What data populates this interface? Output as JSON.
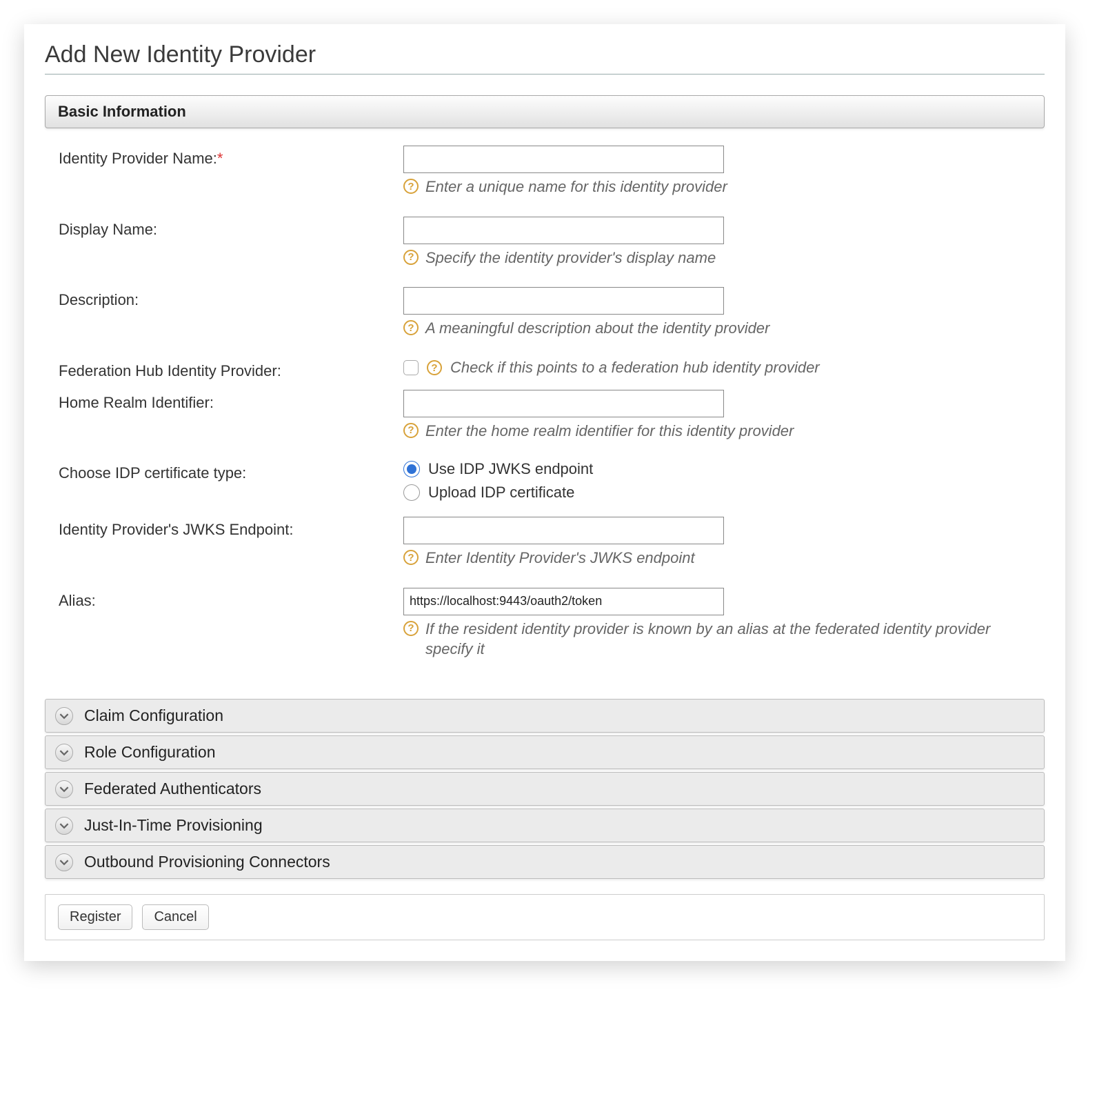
{
  "page": {
    "title": "Add New Identity Provider"
  },
  "basic_info": {
    "header": "Basic Information",
    "idp_name": {
      "label": "Identity Provider Name:",
      "required_mark": "*",
      "value": "",
      "hint": "Enter a unique name for this identity provider"
    },
    "display_name": {
      "label": "Display Name:",
      "value": "",
      "hint": "Specify the identity provider's display name"
    },
    "description": {
      "label": "Description:",
      "value": "",
      "hint": "A meaningful description about the identity provider"
    },
    "federation_hub": {
      "label": "Federation Hub Identity Provider:",
      "checked": false,
      "hint": "Check if this points to a federation hub identity provider"
    },
    "home_realm": {
      "label": "Home Realm Identifier:",
      "value": "",
      "hint": "Enter the home realm identifier for this identity provider"
    },
    "cert_type": {
      "label": "Choose IDP certificate type:",
      "options": [
        {
          "label": "Use IDP JWKS endpoint",
          "selected": true
        },
        {
          "label": "Upload IDP certificate",
          "selected": false
        }
      ]
    },
    "jwks_endpoint": {
      "label": "Identity Provider's JWKS Endpoint:",
      "value": "",
      "hint": "Enter Identity Provider's JWKS endpoint"
    },
    "alias": {
      "label": "Alias:",
      "value": "https://localhost:9443/oauth2/token",
      "hint": "If the resident identity provider is known by an alias at the federated identity provider specify it"
    }
  },
  "accordions": [
    {
      "label": "Claim Configuration"
    },
    {
      "label": "Role Configuration"
    },
    {
      "label": "Federated Authenticators"
    },
    {
      "label": "Just-In-Time Provisioning"
    },
    {
      "label": "Outbound Provisioning Connectors"
    }
  ],
  "buttons": {
    "register": "Register",
    "cancel": "Cancel"
  }
}
